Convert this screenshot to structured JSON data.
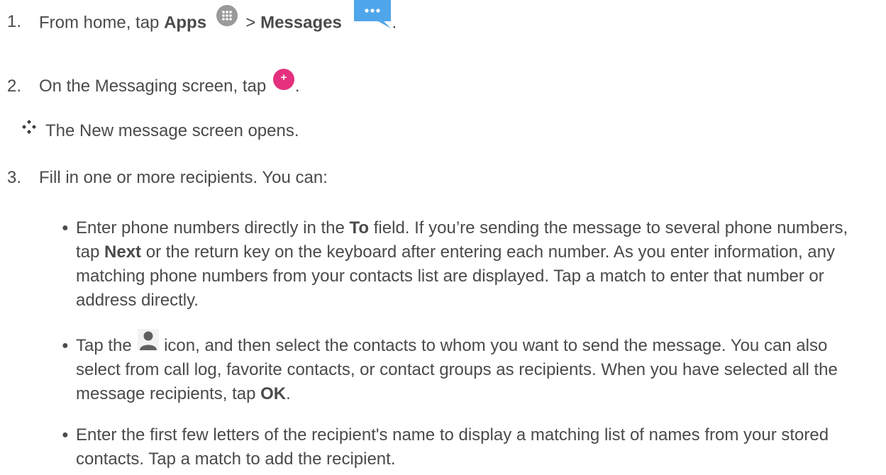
{
  "steps": [
    {
      "number": "1.",
      "pre": "From home, tap ",
      "bold1": "Apps",
      "sep": " > ",
      "bold2": "Messages",
      "post": "."
    },
    {
      "number": "2.",
      "pre": "On the Messaging screen, tap ",
      "post": "."
    },
    {
      "number": "3.",
      "text": "Fill in one or more recipients. You can:"
    }
  ],
  "result": {
    "text": "The New message screen opens."
  },
  "bullets": [
    {
      "pre": "Enter phone numbers directly in the ",
      "bold1": "To",
      "mid": " field. If you’re sending the message to several phone numbers, tap ",
      "bold2": "Next",
      "post": " or the return key on the keyboard after entering each number. As you enter information, any matching phone numbers from your contacts list are displayed. Tap a match to enter that number or address directly."
    },
    {
      "pre": "Tap the ",
      "mid": " icon, and then select the contacts to whom you want to send the message. You can also select from call log, favorite contacts, or contact groups as recipients. When you have selected all the message recipients, tap ",
      "bold1": "OK",
      "post": "."
    },
    {
      "text": "Enter the first few letters of the recipient's name to display a matching list of names from your stored contacts. Tap a match to add the recipient."
    }
  ],
  "icons": {
    "apps": "apps-grid-icon",
    "messages": "messages-bubble-icon",
    "compose": "compose-plus-icon",
    "result": "result-diamond-icon",
    "contacts": "contact-person-icon",
    "bullet": "bullet-dot"
  },
  "colors": {
    "text": "#4a4a4a",
    "messages_blue": "#4fa6ea",
    "compose_pink": "#e5307e",
    "apps_gray": "#9a9a9a"
  }
}
